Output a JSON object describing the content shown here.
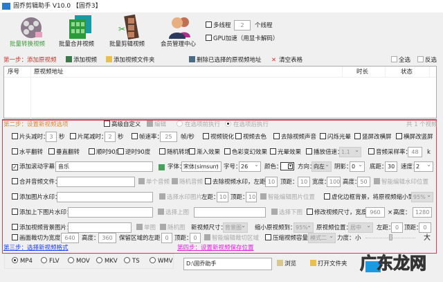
{
  "window": {
    "title": "固乔剪辑助手 V10.0 【固乔3】"
  },
  "toolbar": {
    "items": [
      {
        "label": "批量转换视频",
        "active": true
      },
      {
        "label": "批量合并视频"
      },
      {
        "label": "批量剪辑视频"
      },
      {
        "label": "会员管理中心"
      }
    ],
    "multithread_label": "多线程",
    "threads": "2",
    "threads_unit": "个线程",
    "gpu_label": "GPU加速（用显卡解码）"
  },
  "step1": {
    "title": "第一步：添加原视频",
    "add_video": "添加视频",
    "add_folder": "添加视频文件夹",
    "delete_selected": "删除已选择的原视频地址",
    "clear_table": "清空表格",
    "select_all": "全选",
    "invert": "反选"
  },
  "table": {
    "columns": [
      "序号",
      "原视频地址",
      "时长",
      "状态"
    ],
    "rows": []
  },
  "step2": {
    "title": "第二步：设置新视频选项",
    "advanced": "高级自定义",
    "edit": "编辑",
    "before": "在选项前执行",
    "after": "在选项后执行",
    "count": "共 1 个视频",
    "r1": {
      "head_cut": "片头减时：",
      "head_val": "3",
      "sec1": "秒",
      "tail_cut": "片尾减时：",
      "tail_val": "2",
      "sec2": "秒",
      "fps": "帧速率：",
      "fps_val": "25",
      "fps_unit": "帧/秒",
      "sharpen": "视频锐化",
      "gray": "视频去色",
      "mute": "去除视频声音",
      "flash": "闪烁光晕",
      "v2h": "竖屏改横屏",
      "h2v": "横屏改竖屏"
    },
    "r2": {
      "hflip": "水平翻转",
      "vflip": "垂直翻转",
      "cw": "顺时90度",
      "ccw": "逆时90度",
      "transition": "随机转场",
      "fadein": "渐入效果",
      "color": "色彩变幻效果",
      "halo": "光晕效果",
      "speed": "播放倍速：",
      "speed_val": "1.1",
      "sample": "音频采样率：",
      "sample_val": "48",
      "sample_unit": "k"
    },
    "r3": {
      "subtitle": "添加滚动字幕：",
      "subtitle_val": "音乐",
      "font": "字体：",
      "font_val": "宋体(simsun)",
      "size": "字号：",
      "size_val": "26",
      "color": "颜色：",
      "dir": "方向：",
      "dir_val": "向左",
      "shadow": "阴影：",
      "shadow_val": "0",
      "bottom": "底距：",
      "bottom_val": "30",
      "speed": "速度：",
      "speed_val": "2"
    },
    "r4": {
      "merge_audio": "合并音频文件：",
      "single": "单个音频",
      "random": "随机音频",
      "remove_wm": "去除视频水印，左距：",
      "left": "10",
      "top_l": "顶距：",
      "top": "10",
      "w_l": "宽度：",
      "w": "100",
      "h_l": "高度：",
      "h": "50",
      "smart": "智能编辑水印位置"
    },
    "r5": {
      "img_wm": "添加图片水印：",
      "choose": "选择水印图片",
      "left_l": "左距：",
      "left": "10",
      "top_l": "顶距：",
      "top": "10",
      "smart": "智能编辑图片位置",
      "blur": "虚化边框背景，将原视频缩小到：",
      "blur_val": "95%"
    },
    "r6": {
      "tb_wm": "添加上下图片水印：",
      "choose_top": "选择上图",
      "choose_bottom": "选择下图",
      "resize": "修改视频尺寸，宽度：",
      "w": "960",
      "x": "×",
      "h_l": "高度：",
      "h": "1280"
    },
    "r7": {
      "bg": "添加视频背景图片：",
      "single": "单图",
      "random": "随机图",
      "newsize": "新视频尺寸：",
      "newsize_val": "背景图",
      "shrink": "缩小原视频到：",
      "shrink_val": "95%",
      "pos": "原视频位置：",
      "pos_val": "居中",
      "left_l": "左距：",
      "left": "0",
      "top_l": "顶距：",
      "top": "0"
    },
    "r8": {
      "crop": "画面裁切为宽度：",
      "w": "640",
      "h_l": "高度：",
      "h": "360",
      "keep_left": "保留区域的左距：",
      "left": "0",
      "top_l": "顶距：",
      "top": "0",
      "smart": "智能编辑裁切区域",
      "compress": "压缩视频容量",
      "mode": "模式二",
      "strength": "力度：",
      "small": "小",
      "big": "大",
      "strength_level": 0.5
    }
  },
  "step3": {
    "title": "第三步：选择新视频格式",
    "formats": [
      "MP4",
      "FLV",
      "MOV",
      "MKV",
      "TS",
      "WMV"
    ],
    "selected": "MP4"
  },
  "step4": {
    "title": "第四步：设置新视频保存位置",
    "path": "D:\\固乔助手",
    "browse": "浏览",
    "open_folder": "打开文件夹"
  },
  "watermark": "广东龙网",
  "colors": {
    "step1": "#c0392b",
    "step2": "#d4883a",
    "step3": "#1a3cff",
    "step4": "#e020e0",
    "panel_border": "#d04050"
  }
}
